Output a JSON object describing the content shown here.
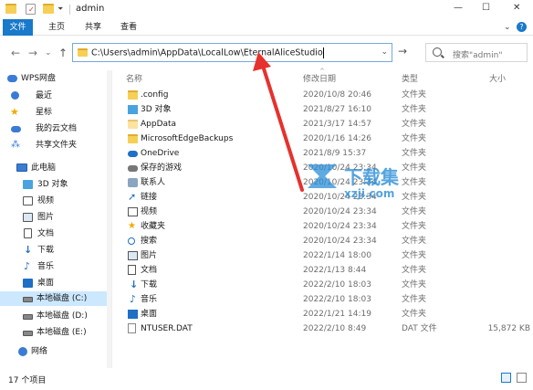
{
  "window": {
    "title": "admin",
    "min": "—",
    "max": "☐",
    "close": "✕"
  },
  "ribbon": {
    "file": "文件",
    "home": "主页",
    "share": "共享",
    "view": "查看",
    "expand": "⌄",
    "help": "?"
  },
  "nav": {
    "back": "←",
    "forward": "→",
    "recent": "⌄",
    "up": "↑",
    "address": "C:\\Users\\admin\\AppData\\LocalLow\\EternalAliceStudio",
    "addr_dropdown": "⌄",
    "go": "→",
    "search_placeholder": "搜索\"admin\""
  },
  "sidebar": {
    "items": [
      {
        "label": "WPS网盘",
        "icon": "cloud-icon",
        "color": "#3a7bd5"
      },
      {
        "label": "最近",
        "icon": "clock-icon",
        "color": "#3a7bd5"
      },
      {
        "label": "星标",
        "icon": "star-icon",
        "color": "#f2a900"
      },
      {
        "label": "我的云文档",
        "icon": "cloud-doc-icon",
        "color": "#3a7bd5"
      },
      {
        "label": "共享文件夹",
        "icon": "share-folder-icon",
        "color": "#3a7bd5"
      },
      {
        "label": "此电脑",
        "icon": "computer-icon",
        "color": "#3a7bd5"
      },
      {
        "label": "3D 对象",
        "icon": "3d-icon",
        "color": "#4aa3df"
      },
      {
        "label": "视频",
        "icon": "video-icon",
        "color": "#555555"
      },
      {
        "label": "图片",
        "icon": "picture-icon",
        "color": "#555555"
      },
      {
        "label": "文档",
        "icon": "document-icon",
        "color": "#555555"
      },
      {
        "label": "下载",
        "icon": "download-icon",
        "color": "#1f6fc5"
      },
      {
        "label": "音乐",
        "icon": "music-icon",
        "color": "#1f6fc5"
      },
      {
        "label": "桌面",
        "icon": "desktop-icon",
        "color": "#1f6fc5"
      },
      {
        "label": "本地磁盘 (C:)",
        "icon": "drive-c-icon",
        "color": "#666666"
      },
      {
        "label": "本地磁盘 (D:)",
        "icon": "drive-d-icon",
        "color": "#666666"
      },
      {
        "label": "本地磁盘 (E:)",
        "icon": "drive-e-icon",
        "color": "#666666"
      },
      {
        "label": "网络",
        "icon": "network-icon",
        "color": "#3a7bd5"
      }
    ]
  },
  "columns": {
    "name": "名称",
    "date": "修改日期",
    "type": "类型",
    "size": "大小"
  },
  "files": [
    {
      "name": ".config",
      "date": "2020/10/8 20:46",
      "type": "文件夹",
      "size": "",
      "icon": "folder-icon"
    },
    {
      "name": "3D 对象",
      "date": "2021/8/27 16:10",
      "type": "文件夹",
      "size": "",
      "icon": "3d-icon"
    },
    {
      "name": "AppData",
      "date": "2021/3/17 14:57",
      "type": "文件夹",
      "size": "",
      "icon": "folder-icon"
    },
    {
      "name": "MicrosoftEdgeBackups",
      "date": "2020/1/16 14:26",
      "type": "文件夹",
      "size": "",
      "icon": "folder-icon"
    },
    {
      "name": "OneDrive",
      "date": "2021/8/9 15:37",
      "type": "文件夹",
      "size": "",
      "icon": "onedrive-icon"
    },
    {
      "name": "保存的游戏",
      "date": "2020/10/24 23:34",
      "type": "文件夹",
      "size": "",
      "icon": "saved-games-icon"
    },
    {
      "name": "联系人",
      "date": "2020/10/24 23:34",
      "type": "文件夹",
      "size": "",
      "icon": "contacts-icon"
    },
    {
      "name": "链接",
      "date": "2020/10/24 23:34",
      "type": "文件夹",
      "size": "",
      "icon": "link-icon"
    },
    {
      "name": "视频",
      "date": "2020/10/24 23:34",
      "type": "文件夹",
      "size": "",
      "icon": "video-icon"
    },
    {
      "name": "收藏夹",
      "date": "2020/10/24 23:34",
      "type": "文件夹",
      "size": "",
      "icon": "favorites-icon"
    },
    {
      "name": "搜索",
      "date": "2020/10/24 23:34",
      "type": "文件夹",
      "size": "",
      "icon": "search-folder-icon"
    },
    {
      "name": "图片",
      "date": "2022/1/14 18:00",
      "type": "文件夹",
      "size": "",
      "icon": "picture-icon"
    },
    {
      "name": "文档",
      "date": "2022/1/13 8:44",
      "type": "文件夹",
      "size": "",
      "icon": "document-icon"
    },
    {
      "name": "下载",
      "date": "2022/2/10 18:03",
      "type": "文件夹",
      "size": "",
      "icon": "download-icon"
    },
    {
      "name": "音乐",
      "date": "2022/2/10 18:03",
      "type": "文件夹",
      "size": "",
      "icon": "music-icon"
    },
    {
      "name": "桌面",
      "date": "2022/1/21 14:19",
      "type": "文件夹",
      "size": "",
      "icon": "desktop-icon"
    },
    {
      "name": "NTUSER.DAT",
      "date": "2022/2/10 8:49",
      "type": "DAT 文件",
      "size": "15,872 KB",
      "icon": "dat-file-icon"
    }
  ],
  "status": {
    "count": "17 个项目"
  },
  "watermark": {
    "brand": "下载集",
    "url": "xzji.com"
  },
  "colors": {
    "accent": "#1979ca",
    "selection": "#cce8ff",
    "arrow": "#e5322d",
    "folder": "#f6cf55"
  }
}
